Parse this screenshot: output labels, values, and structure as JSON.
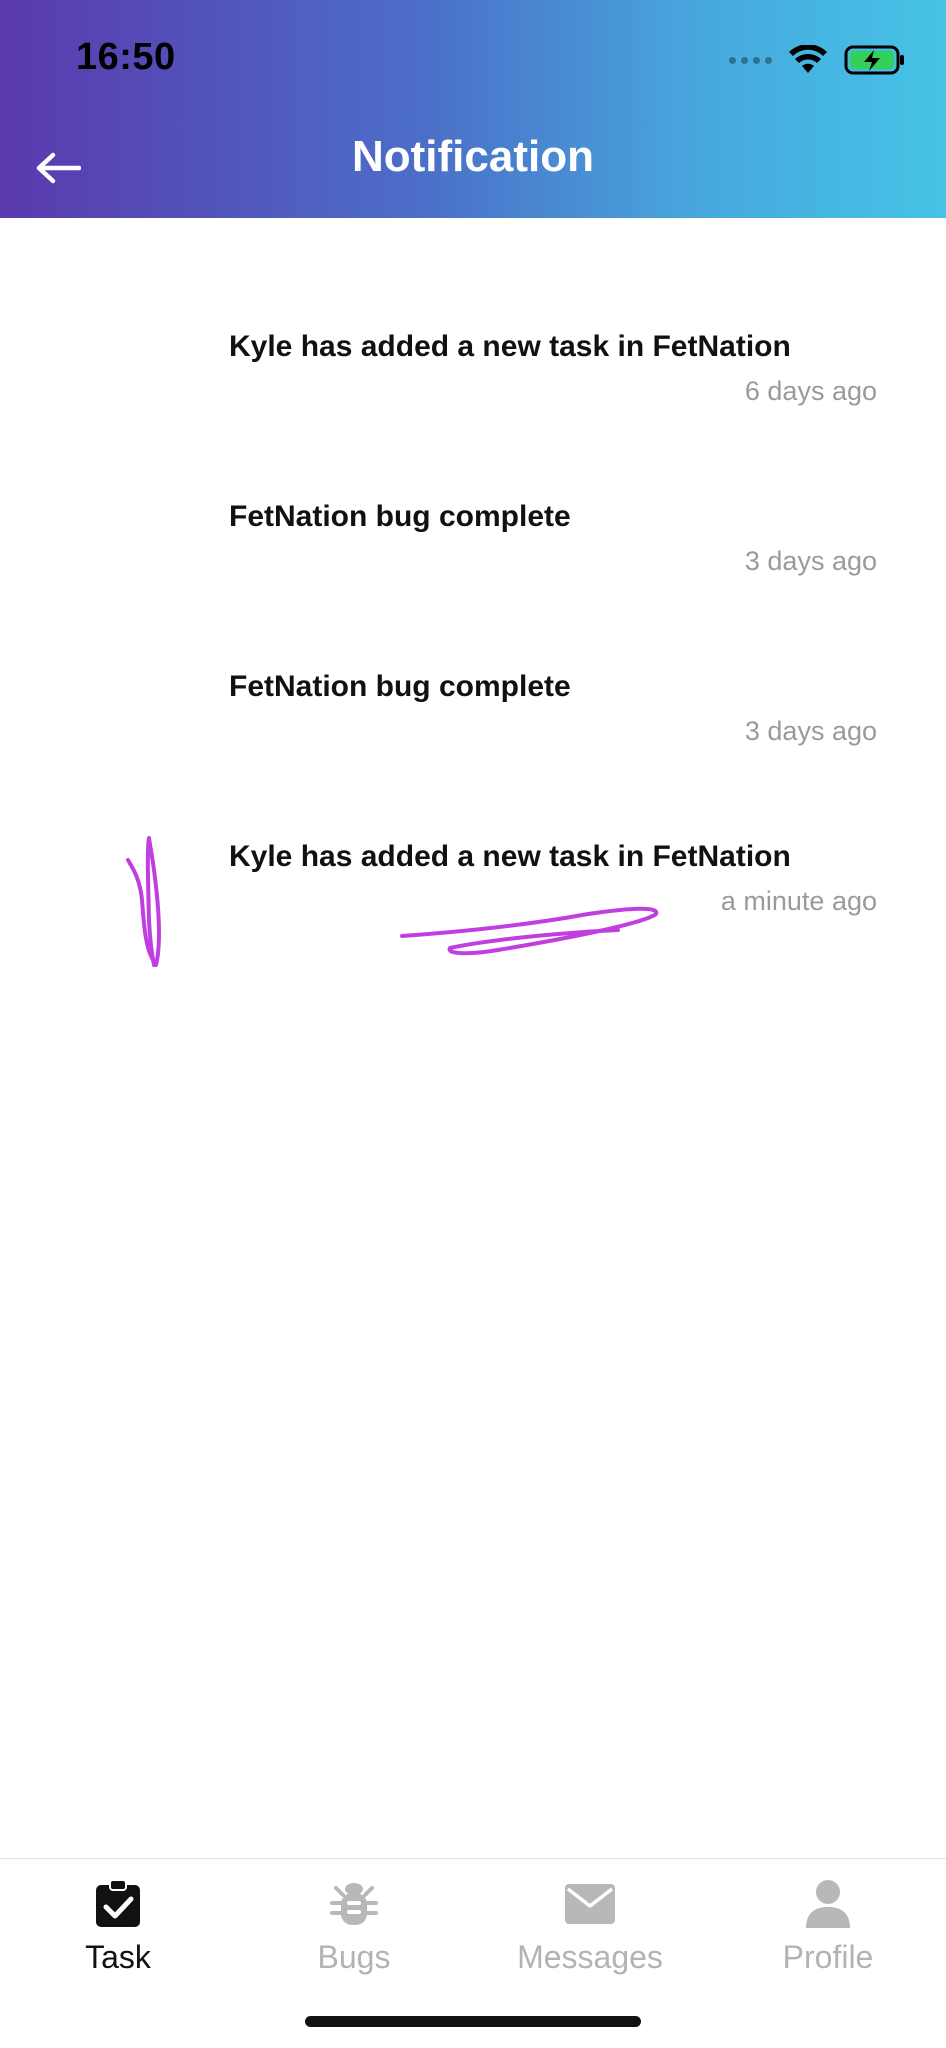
{
  "status_bar": {
    "time": "16:50"
  },
  "header": {
    "title": "Notification",
    "back_icon": "arrow-left-icon",
    "gradient": [
      "#5a39ad",
      "#46c3e6"
    ]
  },
  "notifications": [
    {
      "text": "Kyle has added a new task in FetNation",
      "time": "6 days ago"
    },
    {
      "text": "FetNation bug complete",
      "time": "3 days ago"
    },
    {
      "text": "FetNation bug complete",
      "time": "3 days ago"
    },
    {
      "text": "Kyle has added a new task in FetNation",
      "time": "a minute ago"
    }
  ],
  "annotation_color": "#c13ee0",
  "tabbar": {
    "tabs": [
      {
        "label": "Task",
        "icon": "clipboard-check-icon",
        "active": true
      },
      {
        "label": "Bugs",
        "icon": "bug-icon",
        "active": false
      },
      {
        "label": "Messages",
        "icon": "envelope-icon",
        "active": false
      },
      {
        "label": "Profile",
        "icon": "person-icon",
        "active": false
      }
    ]
  }
}
